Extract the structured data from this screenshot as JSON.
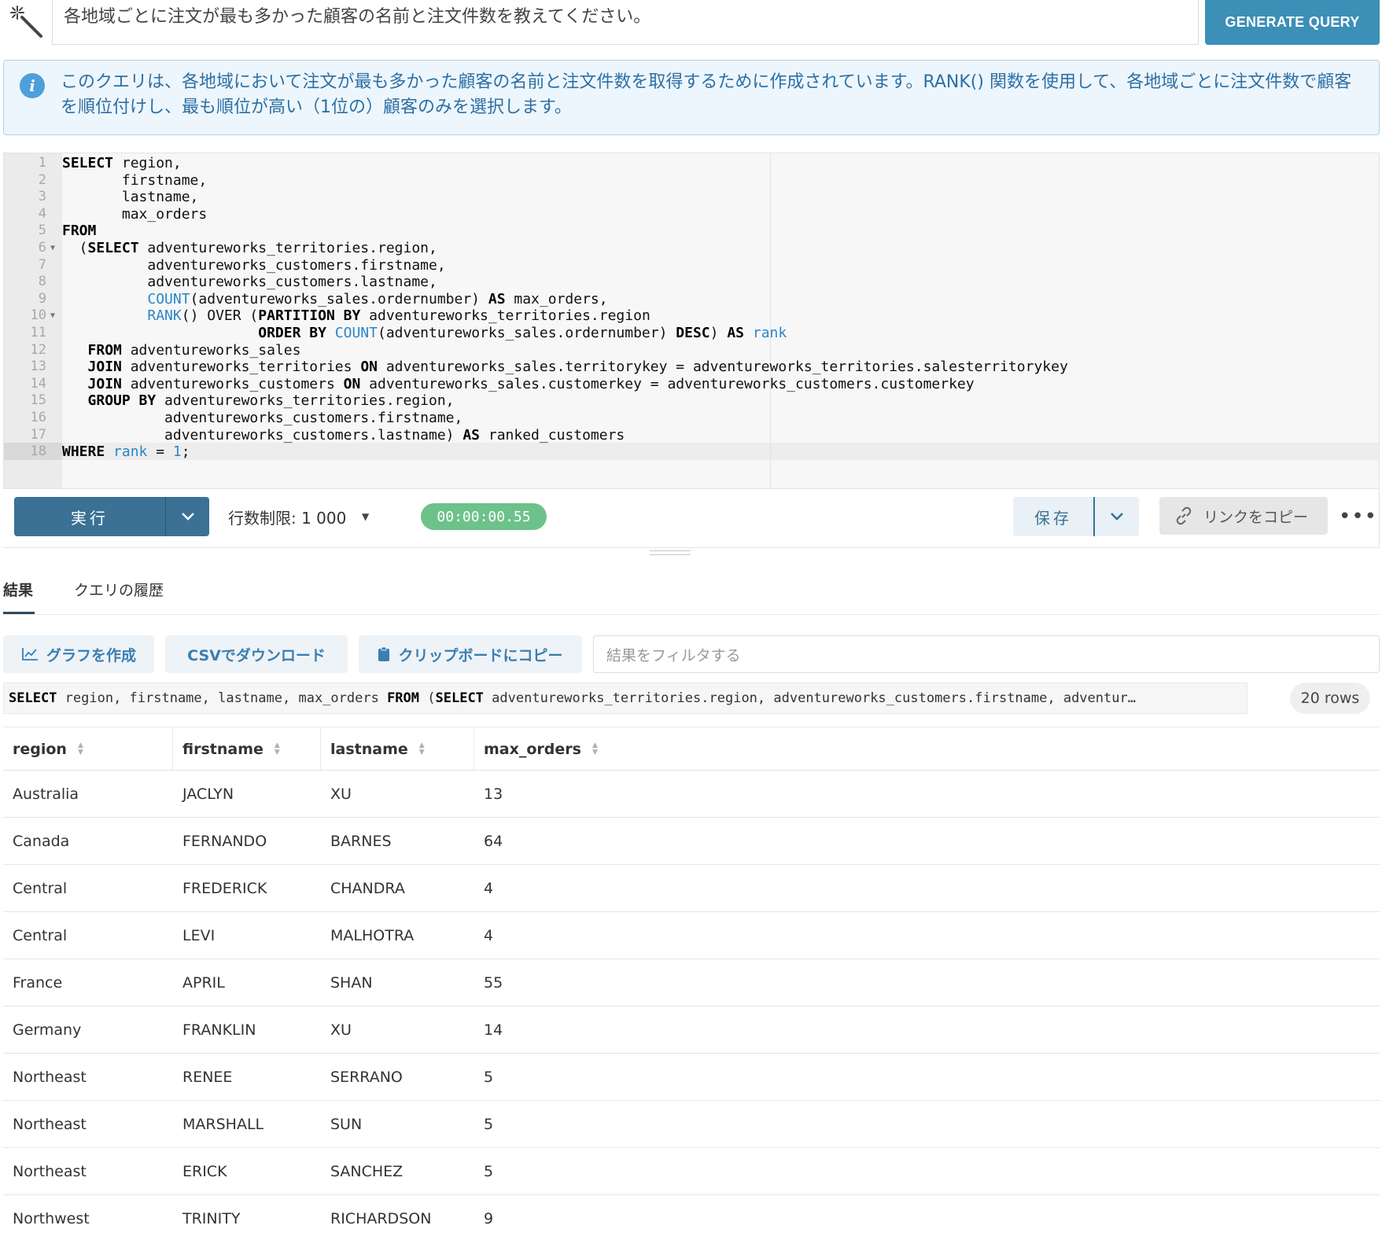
{
  "prompt": {
    "text": "各地域ごとに注文が最も多かった顧客の名前と注文件数を教えてください。",
    "generate_label": "GENERATE QUERY"
  },
  "info": {
    "text": "このクエリは、各地域において注文が最も多かった顧客の名前と注文件数を取得するために作成されています。RANK() 関数を使用して、各地域ごとに注文件数で顧客を順位付けし、最も順位が高い（1位の）顧客のみを選択します。"
  },
  "editor": {
    "lines": [
      {
        "n": "1",
        "fold": false,
        "tokens": [
          {
            "t": "SELECT",
            "c": "kw"
          },
          {
            "t": " region,"
          }
        ]
      },
      {
        "n": "2",
        "fold": false,
        "tokens": [
          {
            "t": "       firstname,"
          }
        ]
      },
      {
        "n": "3",
        "fold": false,
        "tokens": [
          {
            "t": "       lastname,"
          }
        ]
      },
      {
        "n": "4",
        "fold": false,
        "tokens": [
          {
            "t": "       max_orders"
          }
        ]
      },
      {
        "n": "5",
        "fold": false,
        "tokens": [
          {
            "t": "FROM",
            "c": "kw"
          }
        ]
      },
      {
        "n": "6",
        "fold": true,
        "tokens": [
          {
            "t": "  ("
          },
          {
            "t": "SELECT",
            "c": "kw"
          },
          {
            "t": " adventureworks_territories.region,"
          }
        ]
      },
      {
        "n": "7",
        "fold": false,
        "tokens": [
          {
            "t": "          adventureworks_customers.firstname,"
          }
        ]
      },
      {
        "n": "8",
        "fold": false,
        "tokens": [
          {
            "t": "          adventureworks_customers.lastname,"
          }
        ]
      },
      {
        "n": "9",
        "fold": false,
        "tokens": [
          {
            "t": "          "
          },
          {
            "t": "COUNT",
            "c": "fn"
          },
          {
            "t": "(adventureworks_sales.ordernumber) "
          },
          {
            "t": "AS",
            "c": "kw"
          },
          {
            "t": " max_orders,"
          }
        ]
      },
      {
        "n": "10",
        "fold": true,
        "tokens": [
          {
            "t": "          "
          },
          {
            "t": "RANK",
            "c": "fn"
          },
          {
            "t": "() OVER ("
          },
          {
            "t": "PARTITION BY",
            "c": "kw"
          },
          {
            "t": " adventureworks_territories.region"
          }
        ]
      },
      {
        "n": "11",
        "fold": false,
        "tokens": [
          {
            "t": "                       "
          },
          {
            "t": "ORDER BY",
            "c": "kw"
          },
          {
            "t": " "
          },
          {
            "t": "COUNT",
            "c": "fn"
          },
          {
            "t": "(adventureworks_sales.ordernumber) "
          },
          {
            "t": "DESC",
            "c": "kw"
          },
          {
            "t": ") "
          },
          {
            "t": "AS",
            "c": "kw"
          },
          {
            "t": " "
          },
          {
            "t": "rank",
            "c": "fn"
          }
        ]
      },
      {
        "n": "12",
        "fold": false,
        "tokens": [
          {
            "t": "   "
          },
          {
            "t": "FROM",
            "c": "kw"
          },
          {
            "t": " adventureworks_sales"
          }
        ]
      },
      {
        "n": "13",
        "fold": false,
        "tokens": [
          {
            "t": "   "
          },
          {
            "t": "JOIN",
            "c": "kw"
          },
          {
            "t": " adventureworks_territories "
          },
          {
            "t": "ON",
            "c": "kw"
          },
          {
            "t": " adventureworks_sales.territorykey = adventureworks_territories.salesterritorykey"
          }
        ]
      },
      {
        "n": "14",
        "fold": false,
        "tokens": [
          {
            "t": "   "
          },
          {
            "t": "JOIN",
            "c": "kw"
          },
          {
            "t": " adventureworks_customers "
          },
          {
            "t": "ON",
            "c": "kw"
          },
          {
            "t": " adventureworks_sales.customerkey = adventureworks_customers.customerkey"
          }
        ]
      },
      {
        "n": "15",
        "fold": false,
        "tokens": [
          {
            "t": "   "
          },
          {
            "t": "GROUP BY",
            "c": "kw"
          },
          {
            "t": " adventureworks_territories.region,"
          }
        ]
      },
      {
        "n": "16",
        "fold": false,
        "tokens": [
          {
            "t": "            adventureworks_customers.firstname,"
          }
        ]
      },
      {
        "n": "17",
        "fold": false,
        "tokens": [
          {
            "t": "            adventureworks_customers.lastname) "
          },
          {
            "t": "AS",
            "c": "kw"
          },
          {
            "t": " ranked_customers"
          }
        ]
      },
      {
        "n": "18",
        "fold": false,
        "tokens": [
          {
            "t": "WHERE",
            "c": "kw"
          },
          {
            "t": " "
          },
          {
            "t": "rank",
            "c": "fn"
          },
          {
            "t": " = "
          },
          {
            "t": "1",
            "c": "fn"
          },
          {
            "t": ";"
          }
        ]
      }
    ]
  },
  "toolbar": {
    "run_label": "実行",
    "row_limit": "行数制限:  1 000",
    "timer": "00:00:00.55",
    "save_label": "保存",
    "copy_link_label": "リンクをコピー",
    "more_label": "•••"
  },
  "tabs": [
    {
      "label": "結果",
      "active": true
    },
    {
      "label": "クエリの履歴",
      "active": false
    }
  ],
  "actions": {
    "chart_label": "グラフを作成",
    "csv_label": "CSVでダウンロード",
    "clipboard_label": "クリップボードにコピー",
    "filter_placeholder": "結果をフィルタする"
  },
  "sql_preview": {
    "tokens": [
      {
        "t": "SELECT",
        "c": "k"
      },
      {
        "t": " region, firstname, lastname, max_orders "
      },
      {
        "t": "FROM",
        "c": "k"
      },
      {
        "t": " ("
      },
      {
        "t": "SELECT",
        "c": "k"
      },
      {
        "t": " adventureworks_territories.region, adventureworks_customers.firstname, adventur…"
      }
    ]
  },
  "rows_count": "20 rows",
  "table": {
    "columns": [
      "region",
      "firstname",
      "lastname",
      "max_orders"
    ],
    "rows": [
      [
        "Australia",
        "JACLYN",
        "XU",
        "13"
      ],
      [
        "Canada",
        "FERNANDO",
        "BARNES",
        "64"
      ],
      [
        "Central",
        "FREDERICK",
        "CHANDRA",
        "4"
      ],
      [
        "Central",
        "LEVI",
        "MALHOTRA",
        "4"
      ],
      [
        "France",
        "APRIL",
        "SHAN",
        "55"
      ],
      [
        "Germany",
        "FRANKLIN",
        "XU",
        "14"
      ],
      [
        "Northeast",
        "RENEE",
        "SERRANO",
        "5"
      ],
      [
        "Northeast",
        "MARSHALL",
        "SUN",
        "5"
      ],
      [
        "Northeast",
        "ERICK",
        "SANCHEZ",
        "5"
      ],
      [
        "Northwest",
        "TRINITY",
        "RICHARDSON",
        "9"
      ]
    ]
  }
}
